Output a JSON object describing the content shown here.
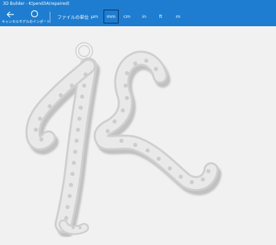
{
  "window": {
    "title": "3D Builder - K(pend3A(repaired)"
  },
  "toolbar": {
    "cancel_label": "キャンセル",
    "import_label": "モデルのインポート",
    "unit_heading": "ファイルの単位",
    "units": [
      "μm",
      "mm",
      "cm",
      "in",
      "ft",
      "m"
    ],
    "selected_unit": "mm"
  },
  "colors": {
    "accent": "#1e7dd0",
    "viewport_bg": "#f1f1f1",
    "model": "#d9d9d9"
  },
  "viewport": {
    "model_icon": "letter-k-pendant-model"
  }
}
